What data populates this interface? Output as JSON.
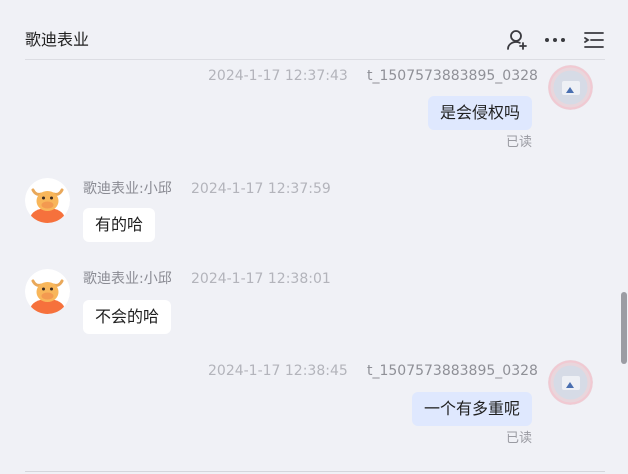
{
  "header": {
    "title": "歌迪表业",
    "icons": [
      "add-user-icon",
      "more-icon",
      "menu-list-icon"
    ]
  },
  "messages": [
    {
      "direction": "out",
      "timestamp": "2024-1-17 12:37:43",
      "sender": "t_1507573883895_0328",
      "text": "是会侵权吗",
      "status": "已读"
    },
    {
      "direction": "in",
      "sender": "歌迪表业:小邱",
      "timestamp": "2024-1-17 12:37:59",
      "text": "有的哈"
    },
    {
      "direction": "in",
      "sender": "歌迪表业:小邱",
      "timestamp": "2024-1-17 12:38:01",
      "text": "不会的哈"
    },
    {
      "direction": "out",
      "timestamp": "2024-1-17 12:38:45",
      "sender": "t_1507573883895_0328",
      "text": "一个有多重呢",
      "status": "已读"
    }
  ],
  "colors": {
    "background": "#f0f1f6",
    "outgoing_bubble": "#dfe8fe",
    "incoming_bubble": "#ffffff",
    "meta_text": "#b3b4bb",
    "shop_avatar_accent": "#f6713c"
  }
}
